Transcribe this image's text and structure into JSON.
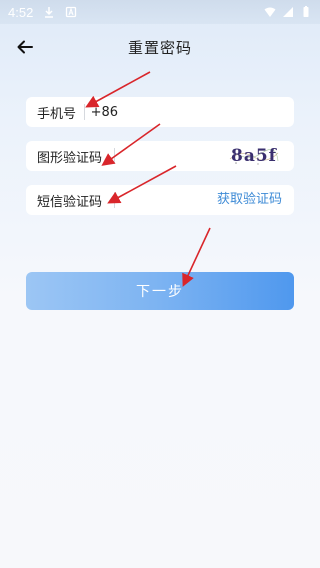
{
  "status_bar": {
    "time": "4:52"
  },
  "header": {
    "title": "重置密码"
  },
  "form": {
    "phone": {
      "label": "手机号",
      "prefix": "+86"
    },
    "image_code": {
      "label": "图形验证码",
      "captcha_text": "8a5f"
    },
    "sms_code": {
      "label": "短信验证码",
      "get_code_label": "获取验证码"
    }
  },
  "next_button": {
    "label": "下一步"
  },
  "colors": {
    "accent": "#3e8bd6",
    "button_start": "#9cc6f4",
    "button_end": "#4f98ee",
    "annotation_arrow": "#d9262b"
  }
}
